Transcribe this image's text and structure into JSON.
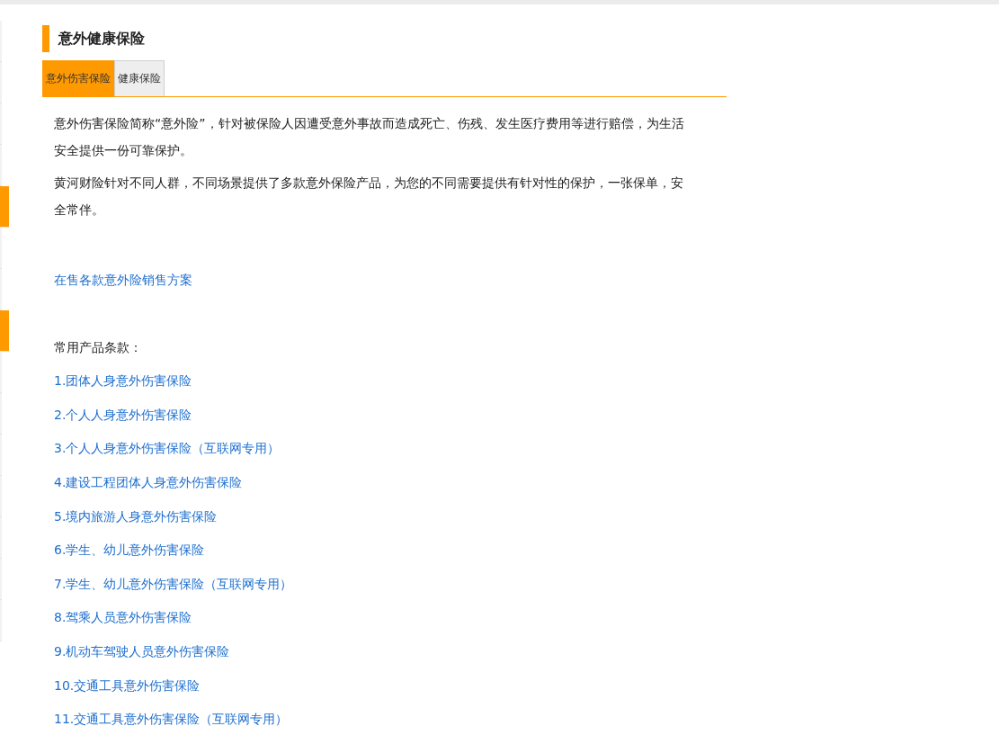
{
  "side_tabs": [
    {
      "selected": false
    },
    {
      "selected": false
    },
    {
      "selected": false
    },
    {
      "selected": false
    },
    {
      "selected": true
    },
    {
      "selected": false
    },
    {
      "selected": false
    },
    {
      "selected": true
    },
    {
      "selected": false
    },
    {
      "selected": false
    },
    {
      "selected": false
    },
    {
      "selected": false
    },
    {
      "selected": false
    },
    {
      "selected": false
    },
    {
      "selected": false
    }
  ],
  "section": {
    "title": "意外健康保险"
  },
  "tabs": [
    {
      "label": "意外伤害保险",
      "selected": true
    },
    {
      "label": "健康保险",
      "selected": false
    }
  ],
  "paragraphs": [
    "意外伤害保险简称“意外险”，针对被保险人因遭受意外事故而造成死亡、伤残、发生医疗费用等进行赔偿，为生活安全提供一份可靠保护。",
    "黄河财险针对不同人群，不同场景提供了多款意外保险产品，为您的不同需要提供有针对性的保护，一张保单，安全常伴。"
  ],
  "sales_link": "在售各款意外险销售方案",
  "products_label": "常用产品条款：",
  "products": [
    "1.团体人身意外伤害保险",
    "2.个人人身意外伤害保险",
    "3.个人人身意外伤害保险（互联网专用）",
    "4.建设工程团体人身意外伤害保险",
    "5.境内旅游人身意外伤害保险",
    "6.学生、幼儿意外伤害保险",
    "7.学生、幼儿意外伤害保险（互联网专用）",
    "8.驾乘人员意外伤害保险",
    "9.机动车驾驶人员意外伤害保险",
    "10.交通工具意外伤害保险",
    "11.交通工具意外伤害保险（互联网专用）"
  ]
}
